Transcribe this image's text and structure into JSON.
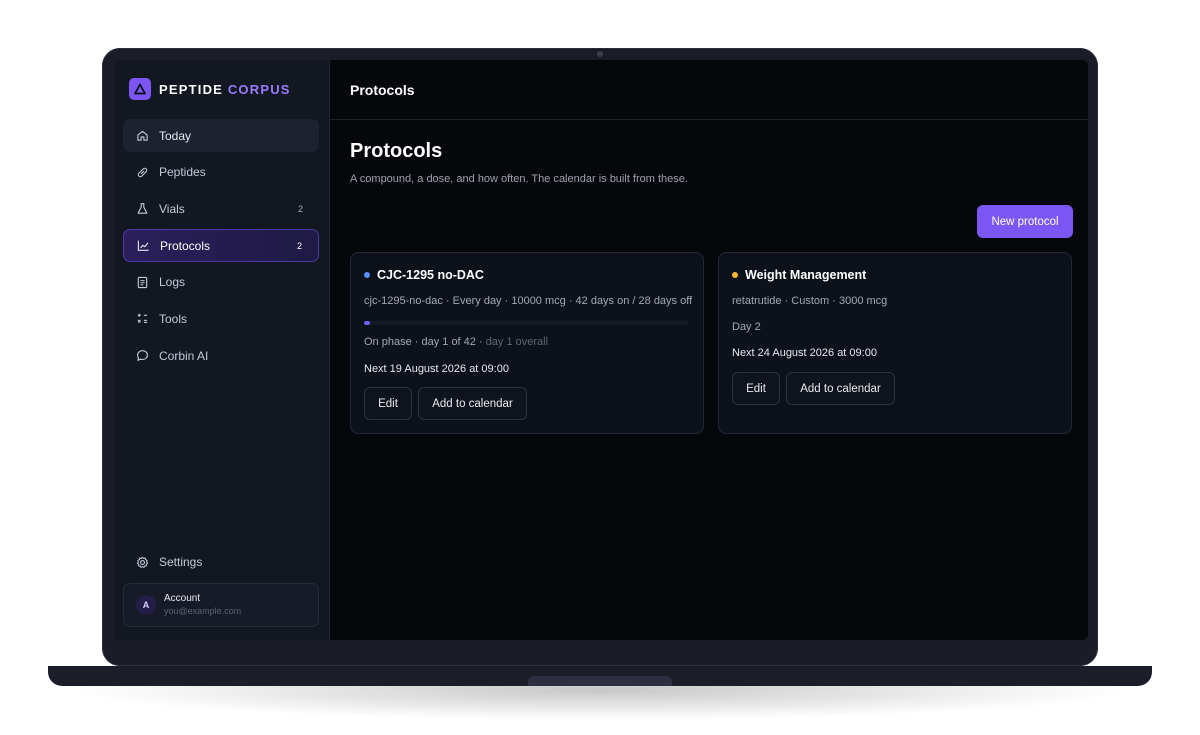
{
  "app": {
    "brand_primary": "PEPTIDE",
    "brand_accent": "CORPUS",
    "accent_color": "#7c56f5"
  },
  "sidebar": {
    "items": [
      {
        "label": "Today",
        "icon": "home-icon"
      },
      {
        "label": "Peptides",
        "icon": "pill-icon"
      },
      {
        "label": "Vials",
        "icon": "flask-icon",
        "count": "2"
      },
      {
        "label": "Protocols",
        "icon": "chart-icon",
        "count": "2"
      },
      {
        "label": "Logs",
        "icon": "document-icon"
      },
      {
        "label": "Tools",
        "icon": "calculator-icon"
      },
      {
        "label": "Corbin AI",
        "icon": "chat-icon"
      }
    ],
    "settings_label": "Settings",
    "account": {
      "avatar_letter": "A",
      "name": "Account",
      "email": "you@example.com"
    }
  },
  "header": {
    "title": "Protocols"
  },
  "main": {
    "title": "Protocols",
    "subtitle": "A compound, a dose, and how often. The calendar is built from these.",
    "new_button": "New protocol",
    "cards": [
      {
        "title": "CJC-1295 no-DAC",
        "dot_color": "#5b8cff",
        "summary": "cjc-1295-no-dac · Every day · 10000 mcg · 42 days on / 28 days off",
        "progress": 0.02,
        "phase": "On phase · day 1 of 42 · ",
        "phase_muted": "day 1 overall",
        "next": "Next 19 August 2026 at 09:00",
        "edit_label": "Edit",
        "calendar_label": "Add to calendar"
      },
      {
        "title": "Weight Management",
        "dot_color": "#f5b82e",
        "summary": "retatrutide · Custom · 3000 mcg",
        "day": "Day 2",
        "next": "Next 24 August 2026 at 09:00",
        "edit_label": "Edit",
        "calendar_label": "Add to calendar"
      }
    ]
  }
}
